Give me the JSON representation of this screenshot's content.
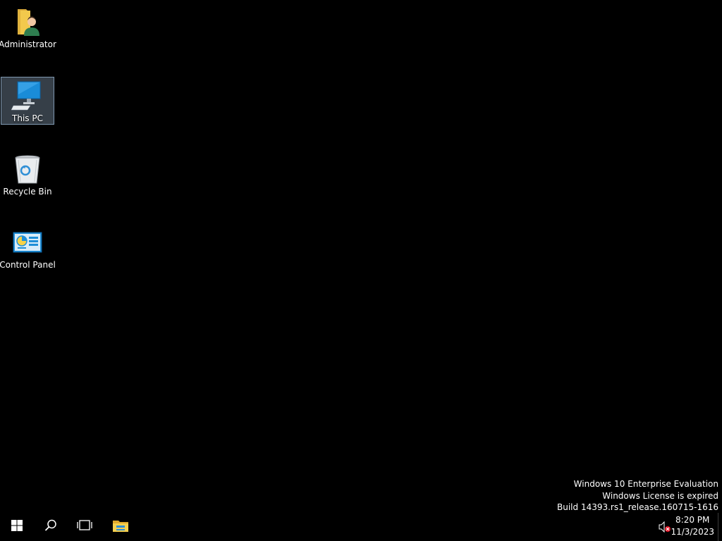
{
  "desktop": {
    "icons": [
      {
        "label": "Administrator",
        "icon": "user-folder-icon",
        "selected": false
      },
      {
        "label": "This PC",
        "icon": "computer-icon",
        "selected": true
      },
      {
        "label": "Recycle Bin",
        "icon": "recycle-bin-icon",
        "selected": false
      },
      {
        "label": "Control Panel",
        "icon": "control-panel-icon",
        "selected": false
      }
    ]
  },
  "watermark": {
    "line1": "Windows 10 Enterprise Evaluation",
    "line2": "Windows License is expired",
    "line3": "Build 14393.rs1_release.160715-1616"
  },
  "taskbar": {
    "start_icon": "windows-logo-icon",
    "search_icon": "search-icon",
    "taskview_icon": "task-view-icon",
    "explorer_icon": "file-explorer-icon",
    "volume_icon": "volume-muted-icon",
    "time": "8:20 PM",
    "date": "11/3/2023"
  },
  "colors": {
    "background": "#000000",
    "selection": "#7f98b0",
    "accent_blue": "#1a8cd8",
    "folder_yellow": "#f2c94c"
  }
}
